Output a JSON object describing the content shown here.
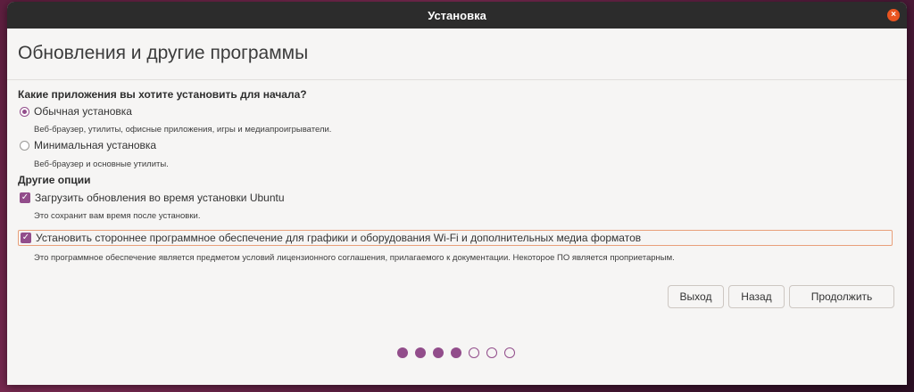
{
  "window": {
    "title": "Установка",
    "close_icon": "×"
  },
  "page_title": "Обновления и другие программы",
  "apps_section": {
    "heading": "Какие приложения вы хотите установить для начала?",
    "options": [
      {
        "label": "Обычная установка",
        "desc": "Веб-браузер, утилиты, офисные приложения, игры и медиапроигрыватели.",
        "selected": true
      },
      {
        "label": "Минимальная установка",
        "desc": "Веб-браузер и основные утилиты.",
        "selected": false
      }
    ]
  },
  "other_section": {
    "heading": "Другие опции",
    "updates": {
      "label": "Загрузить обновления во время установки Ubuntu",
      "desc": "Это сохранит вам время после установки.",
      "checked": true
    },
    "third_party": {
      "label": "Установить стороннее программное обеспечение для графики и оборудования Wi-Fi и дополнительных медиа форматов",
      "desc": "Это программное обеспечение является предметом условий лицензионного соглашения, прилагаемого к документации. Некоторое ПО является проприетарным.",
      "checked": true
    }
  },
  "buttons": {
    "quit": "Выход",
    "back": "Назад",
    "continue": "Продолжить"
  },
  "progress": {
    "total_steps": 7,
    "completed_steps": 4
  },
  "colors": {
    "accent": "#924d8b",
    "close": "#e95420",
    "focus": "#e9a07a",
    "titlebar": "#2c2c2c"
  }
}
